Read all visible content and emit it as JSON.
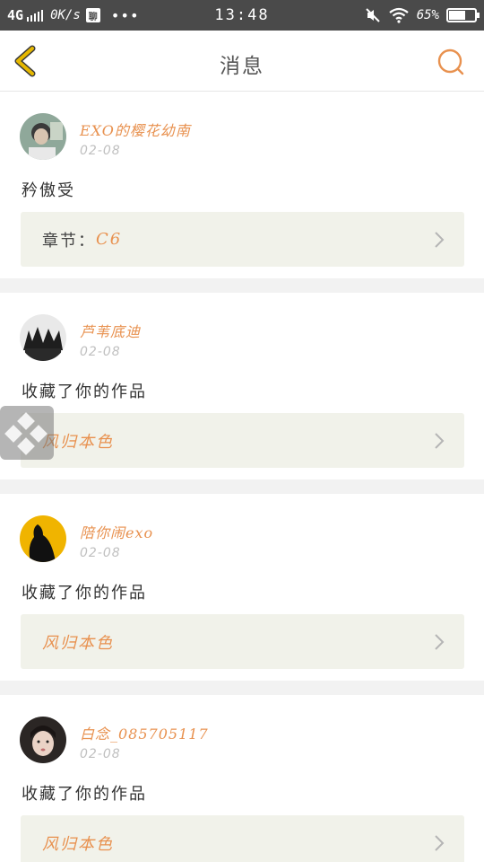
{
  "status_bar": {
    "network": "4G",
    "speed": "0K/s",
    "app_badge": "聊",
    "more": "•••",
    "time": "13:48",
    "battery_pct": "65%",
    "battery_level": 0.65
  },
  "nav": {
    "title": "消息",
    "back_icon": "chevron-left-icon",
    "search_icon": "search-icon"
  },
  "messages": [
    {
      "user": "EXO的樱花幼南",
      "date": "02-08",
      "text": "矜傲受",
      "ref_label": "章节：",
      "ref_value": "C6"
    },
    {
      "user": "芦苇底迪",
      "date": "02-08",
      "text": "收藏了你的作品",
      "ref_label": "",
      "ref_value": "风归本色"
    },
    {
      "user": "陪你闹exo",
      "date": "02-08",
      "text": "收藏了你的作品",
      "ref_label": "",
      "ref_value": "风归本色"
    },
    {
      "user": "白念_085705117",
      "date": "02-08",
      "text": "收藏了你的作品",
      "ref_label": "",
      "ref_value": "风归本色"
    }
  ],
  "colors": {
    "accent": "#e8914f",
    "nav_back": "#e6b800",
    "ref_bg": "#f1f2ea",
    "divider": "#f2f2f2"
  }
}
